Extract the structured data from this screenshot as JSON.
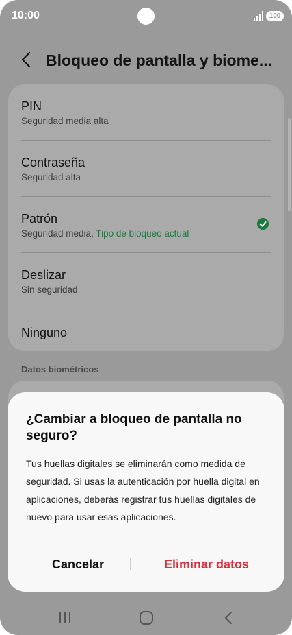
{
  "status_bar": {
    "time": "10:00",
    "battery": "100",
    "icons": [
      "signal-icon",
      "battery-icon",
      "camera-cutout"
    ]
  },
  "header": {
    "title": "Bloqueo de pantalla y biome...",
    "back_icon": "chevron-left-icon"
  },
  "lock_options": [
    {
      "name": "PIN",
      "description": "Seguridad media alta",
      "current_label": ""
    },
    {
      "name": "Contraseña",
      "description": "Seguridad alta",
      "current_label": ""
    },
    {
      "name": "Patrón",
      "description": "Seguridad media, ",
      "current_label": "Tipo de bloqueo actual",
      "selected": true
    },
    {
      "name": "Deslizar",
      "description": "Sin seguridad",
      "current_label": ""
    },
    {
      "name": "Ninguno",
      "description": "",
      "current_label": ""
    }
  ],
  "biometrics_section": {
    "label": "Datos biométricos"
  },
  "dialog": {
    "title": "¿Cambiar a bloqueo de pantalla no seguro?",
    "body": "Tus huellas digitales se eliminarán como medida de seguridad. Si usas la autenticación por huella digital en aplicaciones, deberás registrar tus huellas digitales de nuevo para usar esas aplicaciones.",
    "cancel_label": "Cancelar",
    "confirm_label": "Eliminar datos",
    "confirm_color": "#d1343a"
  },
  "nav_bar": {
    "icons": [
      "recent-apps-icon",
      "home-icon",
      "back-icon"
    ]
  },
  "colors": {
    "accent_green": "#1c7a3f",
    "danger_red": "#d1343a"
  }
}
